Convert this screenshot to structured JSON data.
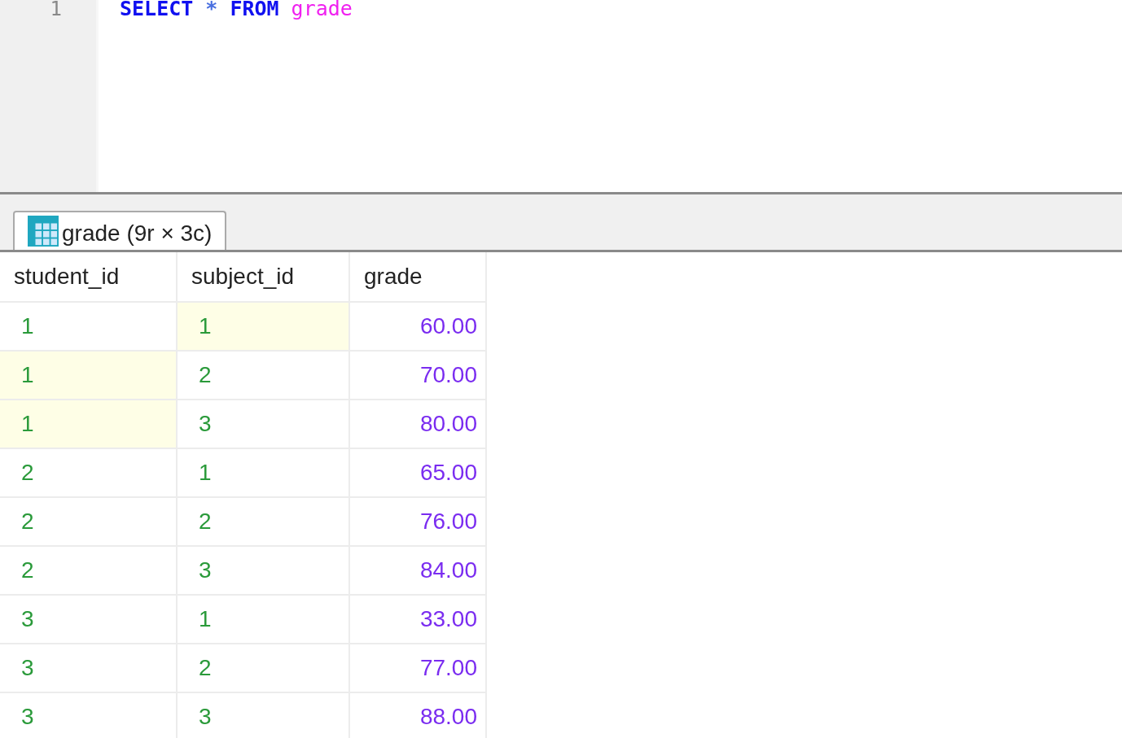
{
  "editor": {
    "lines": [
      {
        "number": "1",
        "tokens": [
          {
            "text": "SELECT",
            "kind": "keyword"
          },
          {
            "text": "*",
            "kind": "operator"
          },
          {
            "text": "FROM",
            "kind": "keyword"
          },
          {
            "text": "grade",
            "kind": "identifier"
          }
        ]
      }
    ]
  },
  "result_tabs": [
    {
      "label": "grade (9r × 3c)",
      "selected": true
    }
  ],
  "table": {
    "columns": [
      {
        "label": "student_id",
        "kind": "integer"
      },
      {
        "label": "subject_id",
        "kind": "integer"
      },
      {
        "label": "grade",
        "kind": "decimal"
      }
    ],
    "rows": [
      [
        {
          "text": "1",
          "highlighted": false
        },
        {
          "text": "1",
          "highlighted": true
        },
        {
          "text": "60.00",
          "highlighted": false
        }
      ],
      [
        {
          "text": "1",
          "highlighted": true
        },
        {
          "text": "2",
          "highlighted": false
        },
        {
          "text": "70.00",
          "highlighted": false
        }
      ],
      [
        {
          "text": "1",
          "highlighted": true
        },
        {
          "text": "3",
          "highlighted": false
        },
        {
          "text": "80.00",
          "highlighted": false
        }
      ],
      [
        {
          "text": "2",
          "highlighted": false
        },
        {
          "text": "1",
          "highlighted": false
        },
        {
          "text": "65.00",
          "highlighted": false
        }
      ],
      [
        {
          "text": "2",
          "highlighted": false
        },
        {
          "text": "2",
          "highlighted": false
        },
        {
          "text": "76.00",
          "highlighted": false
        }
      ],
      [
        {
          "text": "2",
          "highlighted": false
        },
        {
          "text": "3",
          "highlighted": false
        },
        {
          "text": "84.00",
          "highlighted": false
        }
      ],
      [
        {
          "text": "3",
          "highlighted": false
        },
        {
          "text": "1",
          "highlighted": false
        },
        {
          "text": "33.00",
          "highlighted": false
        }
      ],
      [
        {
          "text": "3",
          "highlighted": false
        },
        {
          "text": "2",
          "highlighted": false
        },
        {
          "text": "77.00",
          "highlighted": false
        }
      ],
      [
        {
          "text": "3",
          "highlighted": false
        },
        {
          "text": "3",
          "highlighted": false
        },
        {
          "text": "88.00",
          "highlighted": false
        }
      ]
    ]
  }
}
